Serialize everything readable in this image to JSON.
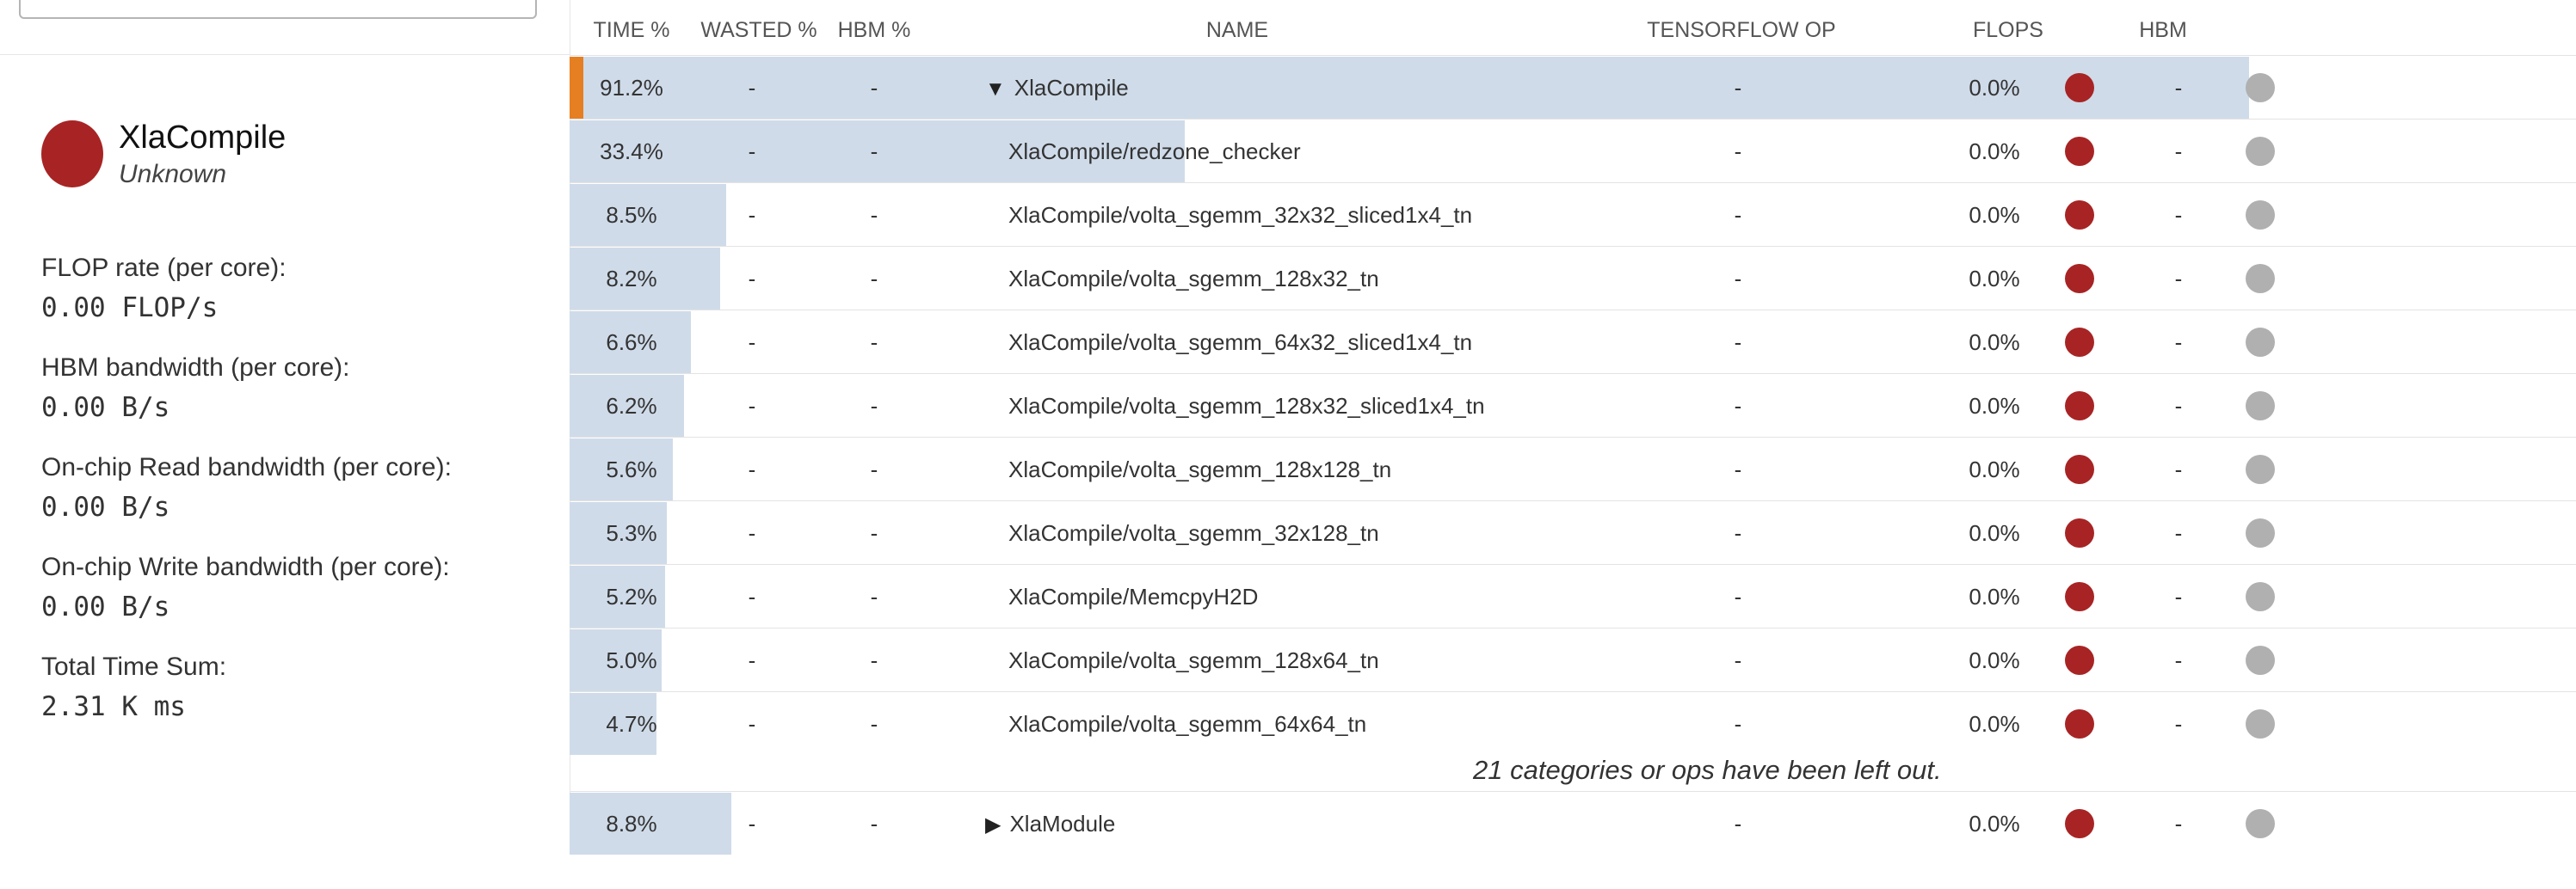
{
  "details": {
    "name": "XlaCompile",
    "type": "Unknown",
    "stats": [
      {
        "label": "FLOP rate (per core):",
        "value": "0.00 FLOP/s"
      },
      {
        "label": "HBM bandwidth (per core):",
        "value": "0.00 B/s"
      },
      {
        "label": "On-chip Read bandwidth (per core):",
        "value": "0.00 B/s"
      },
      {
        "label": "On-chip Write bandwidth (per core):",
        "value": "0.00 B/s"
      },
      {
        "label": "Total Time Sum:",
        "value": "2.31 K ms"
      }
    ],
    "node_color": "#a82424"
  },
  "table": {
    "headers": {
      "time": "TIME %",
      "wasted": "WASTED %",
      "hbm_pct": "HBM %",
      "name": "NAME",
      "tf_op": "TENSORFLOW OP",
      "flops": "FLOPS",
      "hbm": "HBM"
    },
    "rows": [
      {
        "time": "91.2%",
        "time_frac": 0.912,
        "wasted": "-",
        "hbm_pct": "-",
        "name": "XlaCompile",
        "expand": "▼",
        "tf_op": "-",
        "flops": "0.0%",
        "hbm": "-",
        "selected": true
      },
      {
        "time": "33.4%",
        "time_frac": 0.334,
        "wasted": "-",
        "hbm_pct": "-",
        "name": "XlaCompile/redzone_checker",
        "expand": "",
        "tf_op": "-",
        "flops": "0.0%",
        "hbm": "-"
      },
      {
        "time": "8.5%",
        "time_frac": 0.085,
        "wasted": "-",
        "hbm_pct": "-",
        "name": "XlaCompile/volta_sgemm_32x32_sliced1x4_tn",
        "expand": "",
        "tf_op": "-",
        "flops": "0.0%",
        "hbm": "-"
      },
      {
        "time": "8.2%",
        "time_frac": 0.082,
        "wasted": "-",
        "hbm_pct": "-",
        "name": "XlaCompile/volta_sgemm_128x32_tn",
        "expand": "",
        "tf_op": "-",
        "flops": "0.0%",
        "hbm": "-"
      },
      {
        "time": "6.6%",
        "time_frac": 0.066,
        "wasted": "-",
        "hbm_pct": "-",
        "name": "XlaCompile/volta_sgemm_64x32_sliced1x4_tn",
        "expand": "",
        "tf_op": "-",
        "flops": "0.0%",
        "hbm": "-"
      },
      {
        "time": "6.2%",
        "time_frac": 0.062,
        "wasted": "-",
        "hbm_pct": "-",
        "name": "XlaCompile/volta_sgemm_128x32_sliced1x4_tn",
        "expand": "",
        "tf_op": "-",
        "flops": "0.0%",
        "hbm": "-"
      },
      {
        "time": "5.6%",
        "time_frac": 0.056,
        "wasted": "-",
        "hbm_pct": "-",
        "name": "XlaCompile/volta_sgemm_128x128_tn",
        "expand": "",
        "tf_op": "-",
        "flops": "0.0%",
        "hbm": "-"
      },
      {
        "time": "5.3%",
        "time_frac": 0.053,
        "wasted": "-",
        "hbm_pct": "-",
        "name": "XlaCompile/volta_sgemm_32x128_tn",
        "expand": "",
        "tf_op": "-",
        "flops": "0.0%",
        "hbm": "-"
      },
      {
        "time": "5.2%",
        "time_frac": 0.052,
        "wasted": "-",
        "hbm_pct": "-",
        "name": "XlaCompile/MemcpyH2D",
        "expand": "",
        "tf_op": "-",
        "flops": "0.0%",
        "hbm": "-"
      },
      {
        "time": "5.0%",
        "time_frac": 0.05,
        "wasted": "-",
        "hbm_pct": "-",
        "name": "XlaCompile/volta_sgemm_128x64_tn",
        "expand": "",
        "tf_op": "-",
        "flops": "0.0%",
        "hbm": "-"
      },
      {
        "time": "4.7%",
        "time_frac": 0.047,
        "wasted": "-",
        "hbm_pct": "-",
        "name": "XlaCompile/volta_sgemm_64x64_tn",
        "expand": "",
        "tf_op": "-",
        "flops": "0.0%",
        "hbm": "-"
      }
    ],
    "left_out_note": "21 categories or ops have been left out.",
    "last_row": {
      "time": "8.8%",
      "time_frac": 0.088,
      "wasted": "-",
      "hbm_pct": "-",
      "name": "XlaModule",
      "expand": "▶",
      "tf_op": "-",
      "flops": "0.0%",
      "hbm": "-"
    },
    "colors": {
      "bar": "#cfdbe9",
      "selected_marker": "#e67e22",
      "flops_dot": "#a82424",
      "hbm_dot": "#b0b0b0"
    }
  }
}
